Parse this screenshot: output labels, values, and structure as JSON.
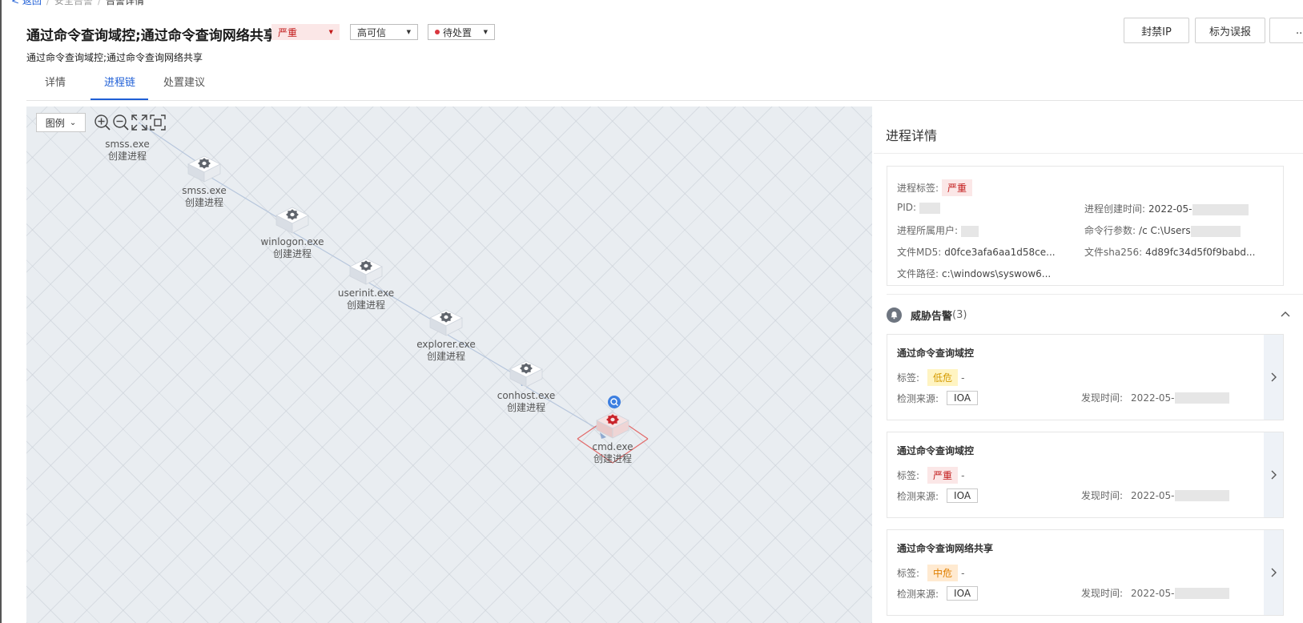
{
  "breadcrumb": {
    "back": "< 返回",
    "parent": "安全告警",
    "current": "告警详情"
  },
  "header": {
    "title": "通过命令查询域控;通过命令查询网络共享",
    "subtitle": "通过命令查询域控;通过命令查询网络共享",
    "severity": "严重",
    "credibility": "高可信",
    "status": "待处置",
    "actions": {
      "ban_ip": "封禁IP",
      "mark_false": "标为误报",
      "more": "..."
    }
  },
  "tabs": [
    "详情",
    "进程链",
    "处置建议"
  ],
  "active_tab": "进程链",
  "graph": {
    "legend_label": "图例",
    "tools": [
      "zoom-in",
      "zoom-out",
      "fullscreen",
      "fit"
    ],
    "nodes": [
      {
        "name": "smss.exe",
        "action": "创建进程"
      },
      {
        "name": "smss.exe",
        "action": "创建进程"
      },
      {
        "name": "winlogon.exe",
        "action": "创建进程"
      },
      {
        "name": "userinit.exe",
        "action": "创建进程"
      },
      {
        "name": "explorer.exe",
        "action": "创建进程"
      },
      {
        "name": "conhost.exe",
        "action": "创建进程"
      },
      {
        "name": "cmd.exe",
        "action": "创建进程",
        "highlighted": true
      }
    ]
  },
  "process_detail": {
    "title": "进程详情",
    "tag_label": "进程标签:",
    "tag_value": "严重",
    "pid_label": "PID:",
    "create_time_label": "进程创建时间:",
    "create_time_value": "2022-05-",
    "user_label": "进程所属用户:",
    "cmdline_label": "命令行参数:",
    "cmdline_value": "/c C:\\Users",
    "md5_label": "文件MD5:",
    "md5_value": "d0fce3afa6aa1d58ce...",
    "sha256_label": "文件sha256:",
    "sha256_value": "4d89fc34d5f0f9babd...",
    "path_label": "文件路径:",
    "path_value": "c:\\windows\\syswow6..."
  },
  "threat_alerts": {
    "title": "威胁告警",
    "count": "(3)",
    "tag_label": "标签:",
    "source_label": "检测来源:",
    "found_label": "发现时间:",
    "items": [
      {
        "title": "通过命令查询域控",
        "tag": "低危",
        "tag_suffix": "-",
        "source": "IOA",
        "found": "2022-05-"
      },
      {
        "title": "通过命令查询域控",
        "tag": "严重",
        "tag_suffix": "-",
        "source": "IOA",
        "found": "2022-05-"
      },
      {
        "title": "通过命令查询网络共享",
        "tag": "中危",
        "tag_suffix": "-",
        "source": "IOA",
        "found": "2022-05-"
      }
    ]
  },
  "colors": {
    "accent": "#1f5fd6",
    "severe": "#c21a1a",
    "low": "#d49a00",
    "medium": "#e07f00",
    "highlight": "#d9363e"
  }
}
